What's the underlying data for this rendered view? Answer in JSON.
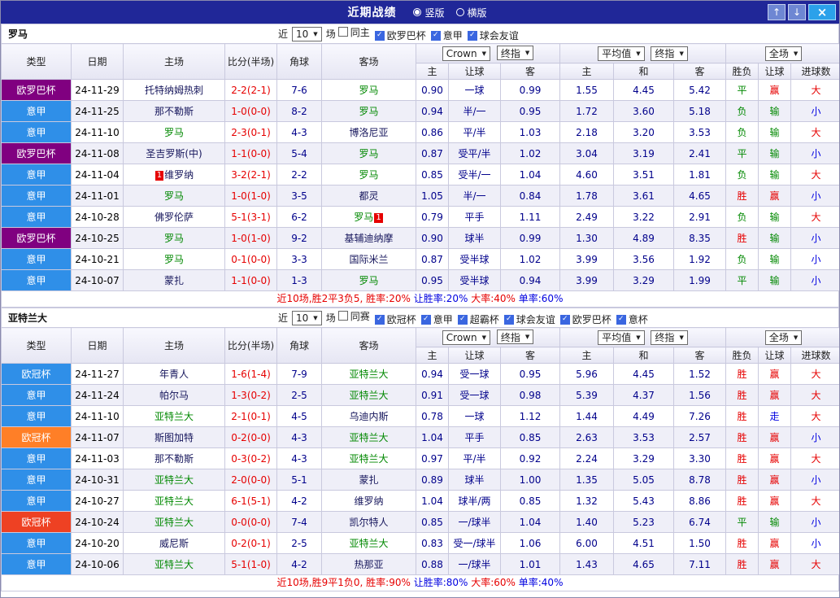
{
  "titlebar": {
    "title": "近期战绩",
    "view_options": [
      {
        "label": "竖版",
        "selected": true
      },
      {
        "label": "横版",
        "selected": false
      }
    ]
  },
  "filters": {
    "bookmaker": "Crown",
    "asian_time": "终指",
    "euro_source": "平均值",
    "euro_time": "终指",
    "scope": "全场"
  },
  "table_headers": {
    "type": "类型",
    "date": "日期",
    "home": "主场",
    "score": "比分(半场)",
    "corner": "角球",
    "away": "客场",
    "asian_home": "主",
    "asian_handicap": "让球",
    "asian_away": "客",
    "euro_home": "主",
    "euro_draw": "和",
    "euro_away": "客",
    "result": "胜负",
    "handicap_result": "让球",
    "goals": "进球数"
  },
  "colors": {
    "titlebar_bg": "#202798",
    "titlebar_text": "#ffffff",
    "btn_up_down": "#6e87d3",
    "btn_close": "#2ba1ea",
    "border": "#c9c9de",
    "row_alt_bg": "#efeff8",
    "league_europa": "#800080",
    "league_serie_a": "#2f8fe8",
    "league_ucl": "#2f8fe8",
    "league_ucl_orange": "#ff7f27",
    "league_ucl_red": "#ee4123",
    "focus_team_green": "#008800",
    "team_navy": "#16165c",
    "score_red": "#e60000",
    "odds_navy": "#00008b",
    "card_red": "#e60000",
    "result_win": "#e60000",
    "result_draw": "#008800",
    "result_loss": "#008800",
    "handicap_win": "#e60000",
    "handicap_loss": "#008800",
    "handicap_push": "#0000e0",
    "goals_big": "#e60000",
    "goals_small": "#0000e0",
    "summary_red": "#e60000",
    "summary_blue": "#0000e0"
  },
  "sections": [
    {
      "team": "罗马",
      "near_label": "近",
      "count": "10",
      "matches_label": "场",
      "checkboxes": [
        {
          "label": "同主",
          "checked": false
        },
        {
          "label": "欧罗巴杯",
          "checked": true
        },
        {
          "label": "意甲",
          "checked": true
        },
        {
          "label": "球会友谊",
          "checked": true
        }
      ],
      "rows": [
        {
          "league": "欧罗巴杯",
          "league_color": "europa",
          "date": "24-11-29",
          "home": "托特纳姆热刺",
          "home_focus": false,
          "score": "2-2(2-1)",
          "corner": "7-6",
          "away": "罗马",
          "away_focus": true,
          "asian_home": "0.90",
          "handicap": "一球",
          "asian_away": "0.99",
          "euro_home": "1.55",
          "euro_draw": "4.45",
          "euro_away": "5.42",
          "result": "平",
          "result_type": "draw",
          "handicap_result": "赢",
          "handicap_type": "win",
          "goals": "大",
          "goals_type": "big"
        },
        {
          "league": "意甲",
          "league_color": "serie_a",
          "date": "24-11-25",
          "home": "那不勒斯",
          "home_focus": false,
          "score": "1-0(0-0)",
          "corner": "8-2",
          "away": "罗马",
          "away_focus": true,
          "asian_home": "0.94",
          "handicap": "半/一",
          "asian_away": "0.95",
          "euro_home": "1.72",
          "euro_draw": "3.60",
          "euro_away": "5.18",
          "result": "负",
          "result_type": "loss",
          "handicap_result": "输",
          "handicap_type": "loss",
          "goals": "小",
          "goals_type": "small"
        },
        {
          "league": "意甲",
          "league_color": "serie_a",
          "date": "24-11-10",
          "home": "罗马",
          "home_focus": true,
          "score": "2-3(0-1)",
          "corner": "4-3",
          "away": "博洛尼亚",
          "away_focus": false,
          "asian_home": "0.86",
          "handicap": "平/半",
          "asian_away": "1.03",
          "euro_home": "2.18",
          "euro_draw": "3.20",
          "euro_away": "3.53",
          "result": "负",
          "result_type": "loss",
          "handicap_result": "输",
          "handicap_type": "loss",
          "goals": "大",
          "goals_type": "big"
        },
        {
          "league": "欧罗巴杯",
          "league_color": "europa",
          "date": "24-11-08",
          "home": "圣吉罗斯(中)",
          "home_focus": false,
          "score": "1-1(0-0)",
          "corner": "5-4",
          "away": "罗马",
          "away_focus": true,
          "asian_home": "0.87",
          "handicap": "受平/半",
          "asian_away": "1.02",
          "euro_home": "3.04",
          "euro_draw": "3.19",
          "euro_away": "2.41",
          "result": "平",
          "result_type": "draw",
          "handicap_result": "输",
          "handicap_type": "loss",
          "goals": "小",
          "goals_type": "small"
        },
        {
          "league": "意甲",
          "league_color": "serie_a",
          "date": "24-11-04",
          "home": "维罗纳",
          "home_focus": false,
          "home_card": "1",
          "score": "3-2(2-1)",
          "corner": "2-2",
          "away": "罗马",
          "away_focus": true,
          "asian_home": "0.85",
          "handicap": "受半/一",
          "asian_away": "1.04",
          "euro_home": "4.60",
          "euro_draw": "3.51",
          "euro_away": "1.81",
          "result": "负",
          "result_type": "loss",
          "handicap_result": "输",
          "handicap_type": "loss",
          "goals": "大",
          "goals_type": "big"
        },
        {
          "league": "意甲",
          "league_color": "serie_a",
          "date": "24-11-01",
          "home": "罗马",
          "home_focus": true,
          "score": "1-0(1-0)",
          "corner": "3-5",
          "away": "都灵",
          "away_focus": false,
          "asian_home": "1.05",
          "handicap": "半/一",
          "asian_away": "0.84",
          "euro_home": "1.78",
          "euro_draw": "3.61",
          "euro_away": "4.65",
          "result": "胜",
          "result_type": "win",
          "handicap_result": "赢",
          "handicap_type": "win",
          "goals": "小",
          "goals_type": "small"
        },
        {
          "league": "意甲",
          "league_color": "serie_a",
          "date": "24-10-28",
          "home": "佛罗伦萨",
          "home_focus": false,
          "score": "5-1(3-1)",
          "corner": "6-2",
          "away": "罗马",
          "away_focus": true,
          "away_card": "1",
          "asian_home": "0.79",
          "handicap": "平手",
          "asian_away": "1.11",
          "euro_home": "2.49",
          "euro_draw": "3.22",
          "euro_away": "2.91",
          "result": "负",
          "result_type": "loss",
          "handicap_result": "输",
          "handicap_type": "loss",
          "goals": "大",
          "goals_type": "big"
        },
        {
          "league": "欧罗巴杯",
          "league_color": "europa",
          "date": "24-10-25",
          "home": "罗马",
          "home_focus": true,
          "score": "1-0(1-0)",
          "corner": "9-2",
          "away": "基辅迪纳摩",
          "away_focus": false,
          "asian_home": "0.90",
          "handicap": "球半",
          "asian_away": "0.99",
          "euro_home": "1.30",
          "euro_draw": "4.89",
          "euro_away": "8.35",
          "result": "胜",
          "result_type": "win",
          "handicap_result": "输",
          "handicap_type": "loss",
          "goals": "小",
          "goals_type": "small"
        },
        {
          "league": "意甲",
          "league_color": "serie_a",
          "date": "24-10-21",
          "home": "罗马",
          "home_focus": true,
          "score": "0-1(0-0)",
          "corner": "3-3",
          "away": "国际米兰",
          "away_focus": false,
          "asian_home": "0.87",
          "handicap": "受半球",
          "asian_away": "1.02",
          "euro_home": "3.99",
          "euro_draw": "3.56",
          "euro_away": "1.92",
          "result": "负",
          "result_type": "loss",
          "handicap_result": "输",
          "handicap_type": "loss",
          "goals": "小",
          "goals_type": "small"
        },
        {
          "league": "意甲",
          "league_color": "serie_a",
          "date": "24-10-07",
          "home": "蒙扎",
          "home_focus": false,
          "score": "1-1(0-0)",
          "corner": "1-3",
          "away": "罗马",
          "away_focus": true,
          "asian_home": "0.95",
          "handicap": "受半球",
          "asian_away": "0.94",
          "euro_home": "3.99",
          "euro_draw": "3.29",
          "euro_away": "1.99",
          "result": "平",
          "result_type": "draw",
          "handicap_result": "输",
          "handicap_type": "loss",
          "goals": "小",
          "goals_type": "small"
        }
      ],
      "summary": [
        {
          "text": "近10场,胜2平3负5, ",
          "color": "red"
        },
        {
          "text": "胜率:20% ",
          "color": "red"
        },
        {
          "text": "让胜率:20% ",
          "color": "blue"
        },
        {
          "text": "大率:40% ",
          "color": "red"
        },
        {
          "text": "单率:60%",
          "color": "blue"
        }
      ]
    },
    {
      "team": "亚特兰大",
      "near_label": "近",
      "count": "10",
      "matches_label": "场",
      "checkboxes": [
        {
          "label": "同赛",
          "checked": false
        },
        {
          "label": "欧冠杯",
          "checked": true
        },
        {
          "label": "意甲",
          "checked": true
        },
        {
          "label": "超霸杯",
          "checked": true
        },
        {
          "label": "球会友谊",
          "checked": true
        },
        {
          "label": "欧罗巴杯",
          "checked": true
        },
        {
          "label": "意杯",
          "checked": true
        }
      ],
      "rows": [
        {
          "league": "欧冠杯",
          "league_color": "ucl",
          "date": "24-11-27",
          "home": "年青人",
          "home_focus": false,
          "score": "1-6(1-4)",
          "corner": "7-9",
          "away": "亚特兰大",
          "away_focus": true,
          "asian_home": "0.94",
          "handicap": "受一球",
          "asian_away": "0.95",
          "euro_home": "5.96",
          "euro_draw": "4.45",
          "euro_away": "1.52",
          "result": "胜",
          "result_type": "win",
          "handicap_result": "赢",
          "handicap_type": "win",
          "goals": "大",
          "goals_type": "big"
        },
        {
          "league": "意甲",
          "league_color": "serie_a",
          "date": "24-11-24",
          "home": "帕尔马",
          "home_focus": false,
          "score": "1-3(0-2)",
          "corner": "2-5",
          "away": "亚特兰大",
          "away_focus": true,
          "asian_home": "0.91",
          "handicap": "受一球",
          "asian_away": "0.98",
          "euro_home": "5.39",
          "euro_draw": "4.37",
          "euro_away": "1.56",
          "result": "胜",
          "result_type": "win",
          "handicap_result": "赢",
          "handicap_type": "win",
          "goals": "大",
          "goals_type": "big"
        },
        {
          "league": "意甲",
          "league_color": "serie_a",
          "date": "24-11-10",
          "home": "亚特兰大",
          "home_focus": true,
          "score": "2-1(0-1)",
          "corner": "4-5",
          "away": "乌迪内斯",
          "away_focus": false,
          "asian_home": "0.78",
          "handicap": "一球",
          "asian_away": "1.12",
          "euro_home": "1.44",
          "euro_draw": "4.49",
          "euro_away": "7.26",
          "result": "胜",
          "result_type": "win",
          "handicap_result": "走",
          "handicap_type": "push",
          "goals": "大",
          "goals_type": "big"
        },
        {
          "league": "欧冠杯",
          "league_color": "ucl_orange",
          "date": "24-11-07",
          "home": "斯图加特",
          "home_focus": false,
          "score": "0-2(0-0)",
          "corner": "4-3",
          "away": "亚特兰大",
          "away_focus": true,
          "asian_home": "1.04",
          "handicap": "平手",
          "asian_away": "0.85",
          "euro_home": "2.63",
          "euro_draw": "3.53",
          "euro_away": "2.57",
          "result": "胜",
          "result_type": "win",
          "handicap_result": "赢",
          "handicap_type": "win",
          "goals": "小",
          "goals_type": "small"
        },
        {
          "league": "意甲",
          "league_color": "serie_a",
          "date": "24-11-03",
          "home": "那不勒斯",
          "home_focus": false,
          "score": "0-3(0-2)",
          "corner": "4-3",
          "away": "亚特兰大",
          "away_focus": true,
          "asian_home": "0.97",
          "handicap": "平/半",
          "asian_away": "0.92",
          "euro_home": "2.24",
          "euro_draw": "3.29",
          "euro_away": "3.30",
          "result": "胜",
          "result_type": "win",
          "handicap_result": "赢",
          "handicap_type": "win",
          "goals": "大",
          "goals_type": "big"
        },
        {
          "league": "意甲",
          "league_color": "serie_a",
          "date": "24-10-31",
          "home": "亚特兰大",
          "home_focus": true,
          "score": "2-0(0-0)",
          "corner": "5-1",
          "away": "蒙扎",
          "away_focus": false,
          "asian_home": "0.89",
          "handicap": "球半",
          "asian_away": "1.00",
          "euro_home": "1.35",
          "euro_draw": "5.05",
          "euro_away": "8.78",
          "result": "胜",
          "result_type": "win",
          "handicap_result": "赢",
          "handicap_type": "win",
          "goals": "小",
          "goals_type": "small"
        },
        {
          "league": "意甲",
          "league_color": "serie_a",
          "date": "24-10-27",
          "home": "亚特兰大",
          "home_focus": true,
          "score": "6-1(5-1)",
          "corner": "4-2",
          "away": "维罗纳",
          "away_focus": false,
          "asian_home": "1.04",
          "handicap": "球半/两",
          "asian_away": "0.85",
          "euro_home": "1.32",
          "euro_draw": "5.43",
          "euro_away": "8.86",
          "result": "胜",
          "result_type": "win",
          "handicap_result": "赢",
          "handicap_type": "win",
          "goals": "大",
          "goals_type": "big"
        },
        {
          "league": "欧冠杯",
          "league_color": "ucl_red",
          "date": "24-10-24",
          "home": "亚特兰大",
          "home_focus": true,
          "score": "0-0(0-0)",
          "corner": "7-4",
          "away": "凯尔特人",
          "away_focus": false,
          "asian_home": "0.85",
          "handicap": "一/球半",
          "asian_away": "1.04",
          "euro_home": "1.40",
          "euro_draw": "5.23",
          "euro_away": "6.74",
          "result": "平",
          "result_type": "draw",
          "handicap_result": "输",
          "handicap_type": "loss",
          "goals": "小",
          "goals_type": "small"
        },
        {
          "league": "意甲",
          "league_color": "serie_a",
          "date": "24-10-20",
          "home": "威尼斯",
          "home_focus": false,
          "score": "0-2(0-1)",
          "corner": "2-5",
          "away": "亚特兰大",
          "away_focus": true,
          "asian_home": "0.83",
          "handicap": "受一/球半",
          "asian_away": "1.06",
          "euro_home": "6.00",
          "euro_draw": "4.51",
          "euro_away": "1.50",
          "result": "胜",
          "result_type": "win",
          "handicap_result": "赢",
          "handicap_type": "win",
          "goals": "小",
          "goals_type": "small"
        },
        {
          "league": "意甲",
          "league_color": "serie_a",
          "date": "24-10-06",
          "home": "亚特兰大",
          "home_focus": true,
          "score": "5-1(1-0)",
          "corner": "4-2",
          "away": "热那亚",
          "away_focus": false,
          "asian_home": "0.88",
          "handicap": "一/球半",
          "asian_away": "1.01",
          "euro_home": "1.43",
          "euro_draw": "4.65",
          "euro_away": "7.11",
          "result": "胜",
          "result_type": "win",
          "handicap_result": "赢",
          "handicap_type": "win",
          "goals": "大",
          "goals_type": "big"
        }
      ],
      "summary": [
        {
          "text": "近10场,胜9平1负0, ",
          "color": "red"
        },
        {
          "text": "胜率:90% ",
          "color": "red"
        },
        {
          "text": "让胜率:80% ",
          "color": "blue"
        },
        {
          "text": "大率:60% ",
          "color": "red"
        },
        {
          "text": "单率:40%",
          "color": "blue"
        }
      ]
    }
  ]
}
